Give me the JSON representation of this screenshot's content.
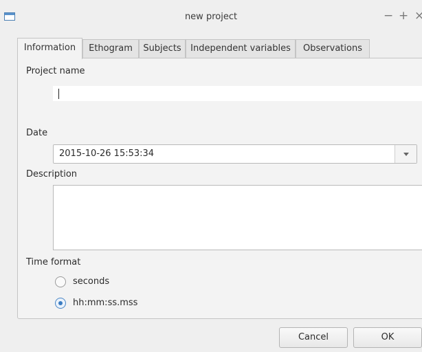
{
  "window": {
    "title": "new project",
    "minimize_glyph": "−",
    "maximize_glyph": "+",
    "close_glyph": "×"
  },
  "tabs": [
    "Information",
    "Ethogram",
    "Subjects",
    "Independent variables",
    "Observations"
  ],
  "active_tab": "Information",
  "form": {
    "project_name_label": "Project name",
    "project_name_value": "",
    "date_label": "Date",
    "date_value": "2015-10-26 15:53:34",
    "description_label": "Description",
    "description_value": "",
    "time_format_label": "Time format",
    "time_format_options": [
      "seconds",
      "hh:mm:ss.mss"
    ],
    "time_format_selected": "hh:mm:ss.mss"
  },
  "buttons": {
    "cancel": "Cancel",
    "ok": "OK"
  },
  "colors": {
    "accent": "#3b7cc2",
    "background": "#efefef",
    "panel": "#f3f3f3"
  }
}
